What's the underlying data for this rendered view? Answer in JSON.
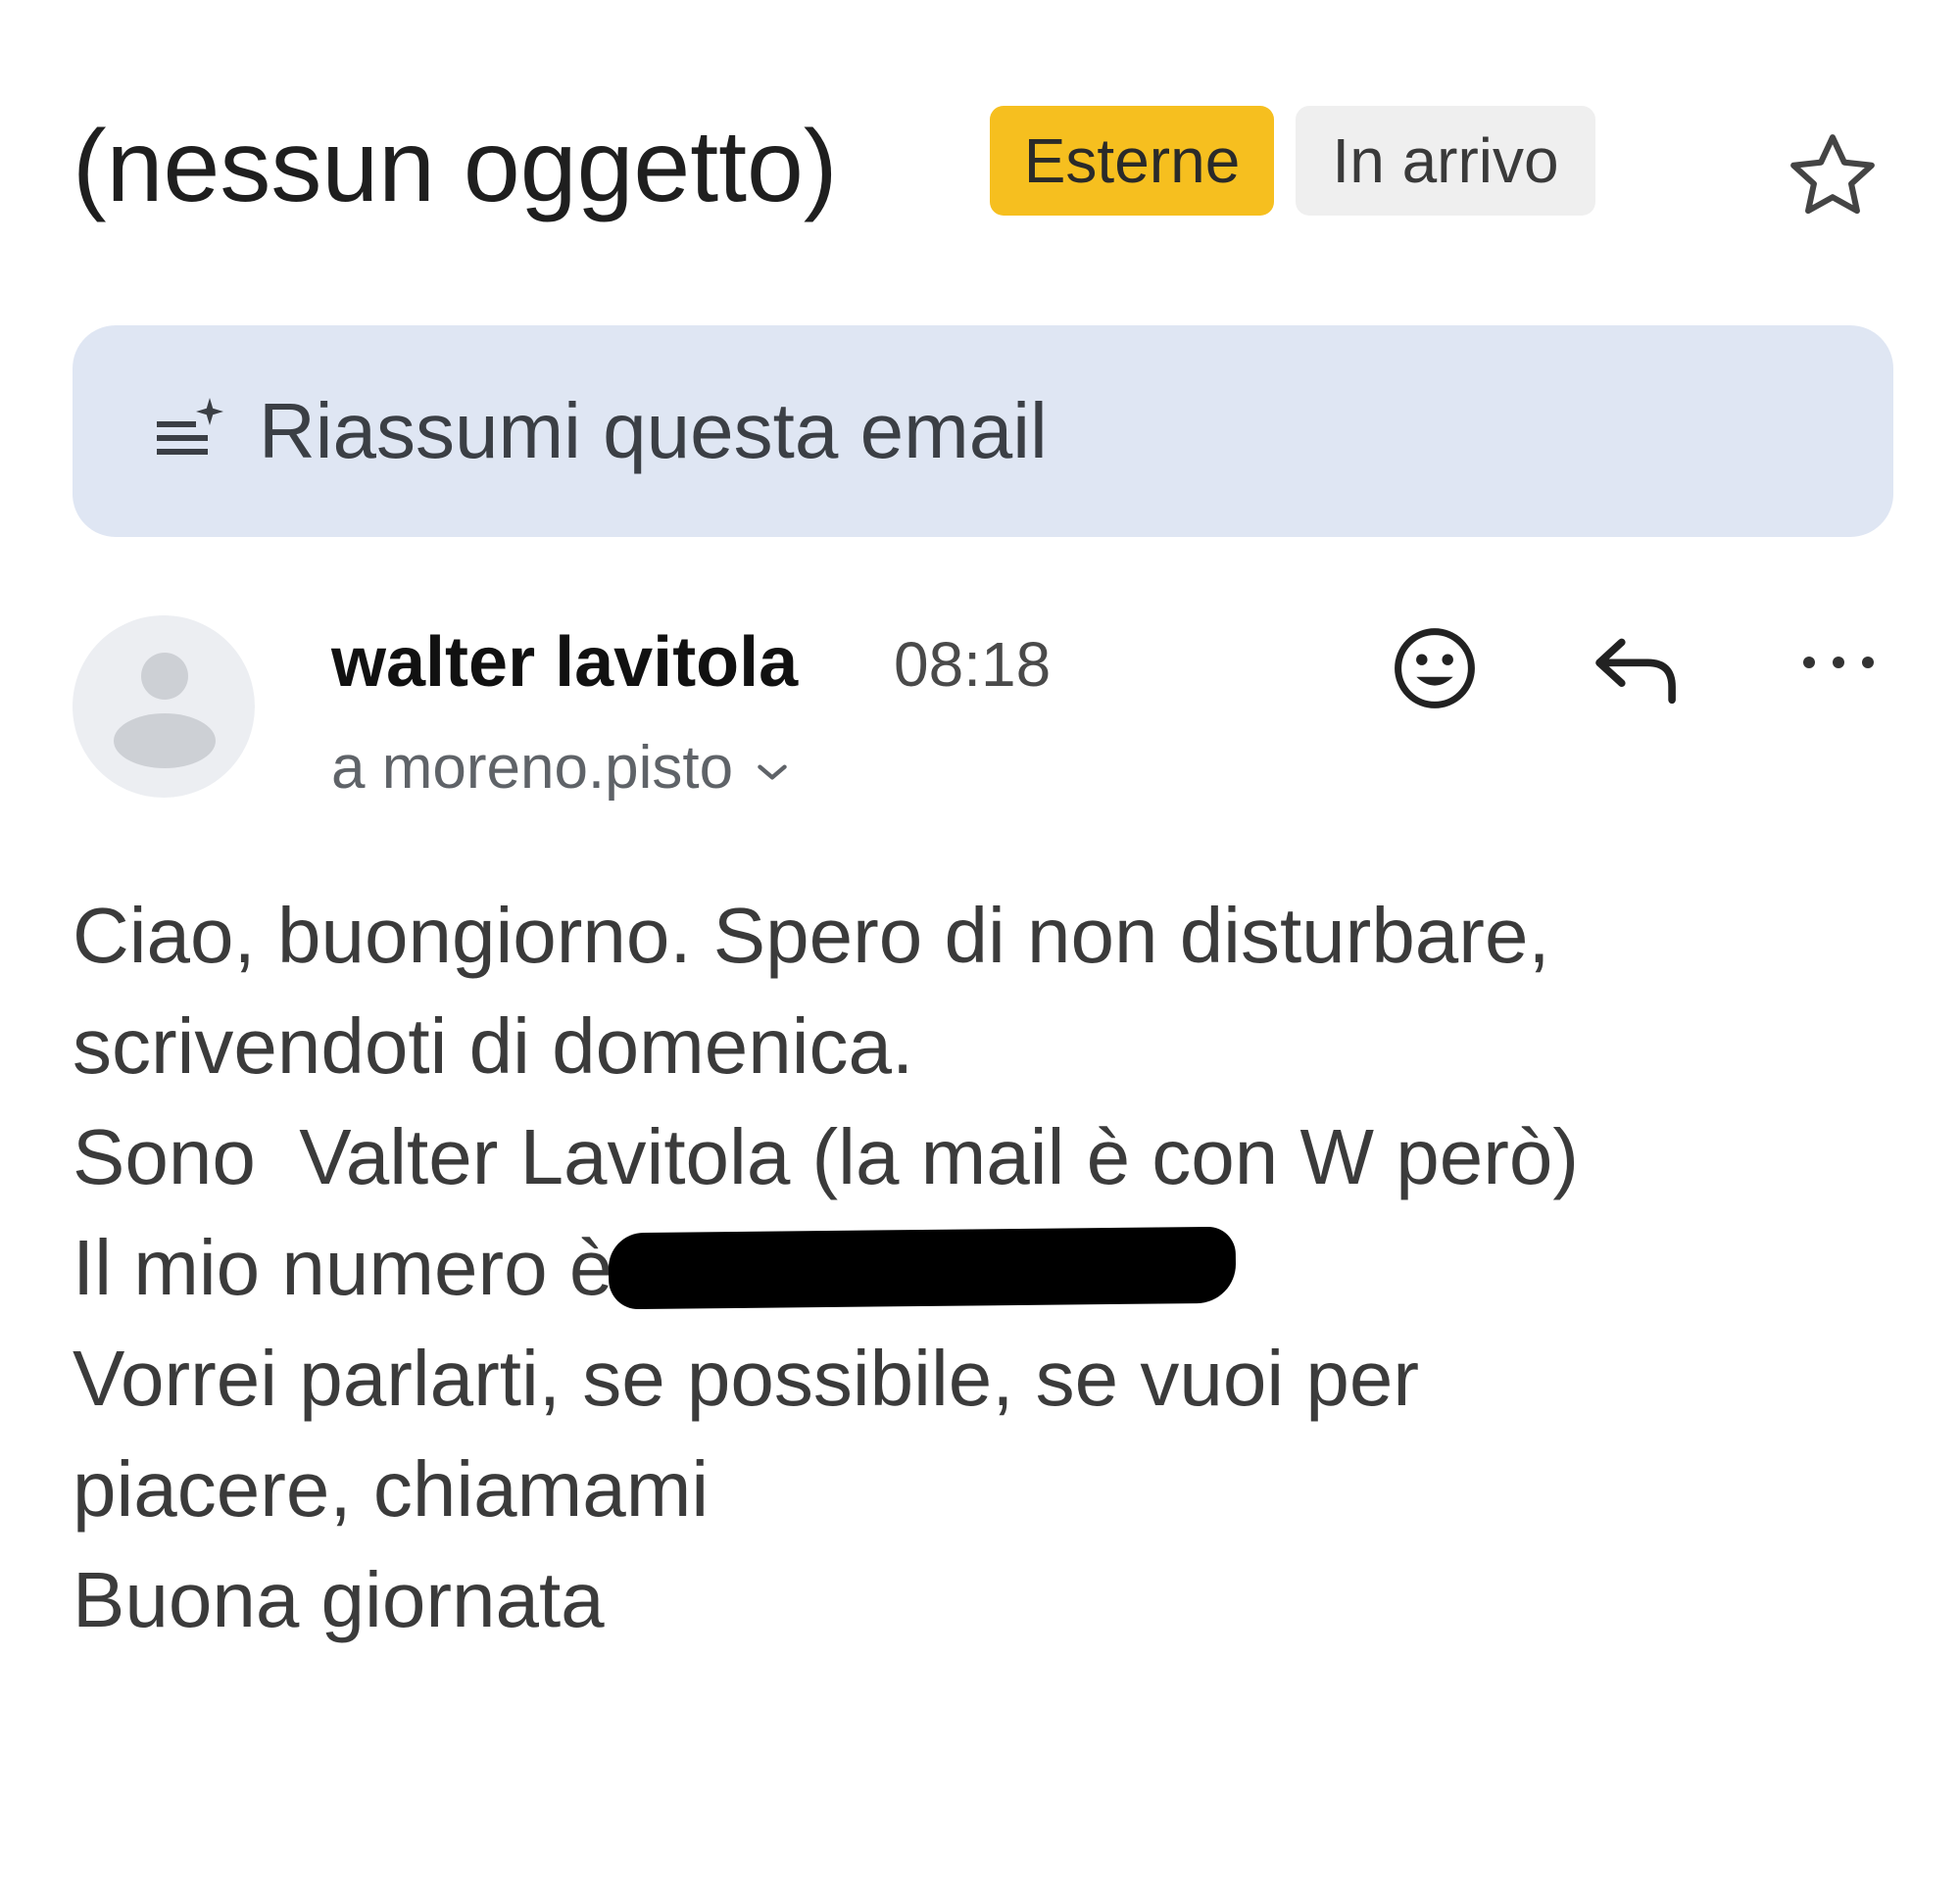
{
  "header": {
    "subject": "(nessun oggetto)",
    "labels": [
      {
        "text": "Esterne",
        "color": "#f6bf1f"
      },
      {
        "text": "In arrivo",
        "color": "#efefef"
      }
    ],
    "star_icon": "star-outline-icon"
  },
  "summary_button": {
    "label": "Riassumi questa email",
    "icon": "summarize-sparkle-icon"
  },
  "message": {
    "sender_name": "walter lavitola",
    "time": "08:18",
    "recipient": "a moreno.pisto",
    "actions": [
      "emoji-reaction-icon",
      "reply-icon",
      "more-options-icon"
    ],
    "body_lines": [
      "Ciao, buongiorno. Spero di non disturbare,",
      "scrivendoti di domenica.",
      "Sono  Valter Lavitola (la mail è con W però)",
      "Il mio numero è",
      "Vorrei parlarti, se possibile, se vuoi per",
      "piacere, chiamami",
      "Buona giornata"
    ]
  }
}
